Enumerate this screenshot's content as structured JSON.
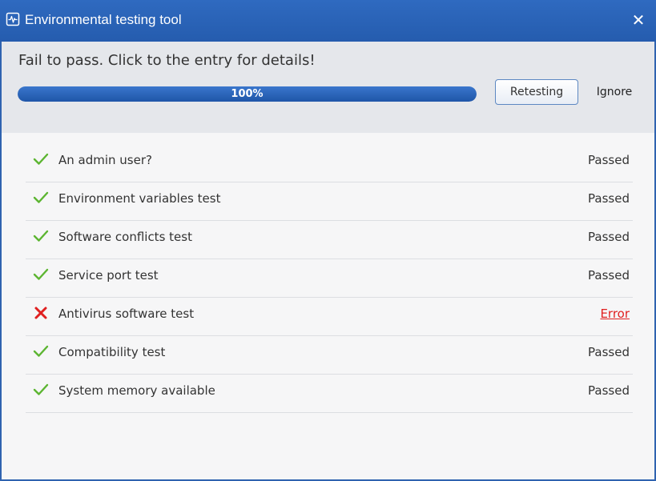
{
  "window": {
    "title": "Environmental testing tool",
    "close_glyph": "✕"
  },
  "header": {
    "message": "Fail to pass. Click to the entry for details!",
    "progress_label": "100%",
    "progress_fraction": 1.0,
    "retest_label": "Retesting",
    "ignore_label": "Ignore"
  },
  "colors": {
    "accent": "#2f63b0",
    "pass": "#5cb531",
    "error": "#e02020"
  },
  "tests": [
    {
      "label": "An admin user?",
      "status": "Passed",
      "result": "pass",
      "icon": "check-icon"
    },
    {
      "label": "Environment variables test",
      "status": "Passed",
      "result": "pass",
      "icon": "check-icon"
    },
    {
      "label": "Software conflicts test",
      "status": "Passed",
      "result": "pass",
      "icon": "check-icon"
    },
    {
      "label": "Service port test",
      "status": "Passed",
      "result": "pass",
      "icon": "check-icon"
    },
    {
      "label": "Antivirus software test",
      "status": "Error",
      "result": "error",
      "icon": "cross-icon"
    },
    {
      "label": "Compatibility test",
      "status": "Passed",
      "result": "pass",
      "icon": "check-icon"
    },
    {
      "label": "System memory available",
      "status": "Passed",
      "result": "pass",
      "icon": "check-icon"
    }
  ]
}
